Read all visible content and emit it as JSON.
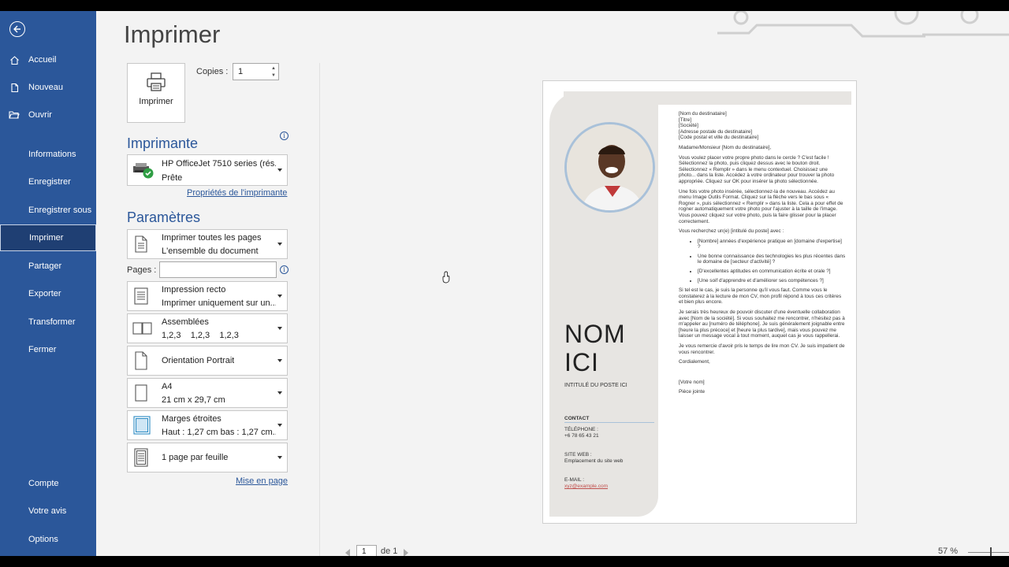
{
  "sidebar": {
    "top_items": [
      {
        "label": "Accueil",
        "icon": "home-icon"
      },
      {
        "label": "Nouveau",
        "icon": "new-document-icon"
      },
      {
        "label": "Ouvrir",
        "icon": "folder-open-icon"
      }
    ],
    "mid_items": [
      "Informations",
      "Enregistrer",
      "Enregistrer sous",
      "Imprimer",
      "Partager",
      "Exporter",
      "Transformer",
      "Fermer"
    ],
    "active": "Imprimer",
    "bottom_items": [
      "Compte",
      "Votre avis",
      "Options"
    ]
  },
  "main": {
    "title": "Imprimer",
    "print_button": "Imprimer",
    "copies_label": "Copies :",
    "copies_value": "1",
    "printer_section": "Imprimante",
    "printer_name": "HP OfficeJet 7510 series (rés...",
    "printer_status": "Prête",
    "printer_props": "Propriétés de l'imprimante",
    "settings_section": "Paramètres",
    "print_what_1": "Imprimer toutes les pages",
    "print_what_2": "L'ensemble du document",
    "pages_label": "Pages :",
    "sides_1": "Impression recto",
    "sides_2": "Imprimer uniquement sur un...",
    "collate_1": "Assemblées",
    "collate_2": "1,2,3    1,2,3    1,2,3",
    "orientation": "Orientation Portrait",
    "paper_1": "A4",
    "paper_2": "21 cm x 29,7 cm",
    "margins_1": "Marges étroites",
    "margins_2": "Haut : 1,27 cm bas : 1,27 cm...",
    "per_sheet": "1 page par feuille",
    "page_setup": "Mise en page"
  },
  "preview": {
    "name_line1": "NOM",
    "name_line2": "ICI",
    "job_title": "INTITULÉ DU POSTE ICI",
    "contact_heading": "CONTACT",
    "phone_label": "TÉLÉPHONE :",
    "phone_value": "+6 78 65 43 21",
    "web_label": "SITE WEB :",
    "web_value": "Emplacement du site web",
    "email_label": "E-MAIL :",
    "email_value": "xyz@example.com",
    "address": [
      "[Nom du destinataire]",
      "[Titre]",
      "[Société]",
      "[Adresse postale du destinataire]",
      "[Code postal et ville du destinataire]"
    ],
    "salutation": "Madame/Monsieur [Nom du destinataire],",
    "p1": "Vous voulez placer votre propre photo dans le cercle ? C'est facile ! Sélectionnez la photo, puis cliquez dessus avec le bouton droit. Sélectionnez « Remplir » dans le menu contextuel. Choisissez une photo... dans la liste. Accédez à votre ordinateur pour trouver la photo appropriée. Cliquez sur OK pour insérer la photo sélectionnée.",
    "p2": "Une fois votre photo insérée, sélectionnez-la de nouveau. Accédez au menu Image Outils Format. Cliquez sur la flèche vers le bas sous « Rogner », puis sélectionnez « Remplir » dans la liste. Cela a pour effet de rogner automatiquement votre photo pour l'ajuster à la taille de l'image. Vous pouvez cliquez sur votre photo, puis la faire glisser pour la placer correctement.",
    "p3": "Vous recherchez un(e) [intitulé du poste] avec :",
    "bullets": [
      "[Nombre] années d'expérience pratique en [domaine d'expertise] ?",
      "Une bonne connaissance des technologies les plus récentes dans le domaine de [secteur d'activité] ?",
      "[D'excellentes aptitudes en communication écrite et orale ?]",
      "[Une soif d'apprendre et d'améliorer ses compétences ?]"
    ],
    "p4": "Si tel est le cas, je suis la personne qu'il vous faut. Comme vous le constaterez à la lecture de mon CV, mon profil répond à tous ces critères et bien plus encore.",
    "p5": "Je serais très heureux de pouvoir discuter d'une éventuelle collaboration avec [Nom de la société]. Si vous souhaitez me rencontrer, n'hésitez pas à m'appeler au [numéro de téléphone]. Je suis généralement joignable entre [heure la plus précoce] et [heure la plus tardive], mais vous pouvez me laisser un message vocal à tout moment, auquel cas je vous rappellerai.",
    "p6": "Je vous remercie d'avoir pris le temps de lire mon CV. Je suis impatient de vous rencontrer.",
    "closing": "Cordialement,",
    "signature": "[Votre nom]",
    "enclosure": "Pièce jointe"
  },
  "footer": {
    "page_value": "1",
    "of_label": "de 1",
    "zoom": "57 %"
  },
  "colors": {
    "sidebar": "#2b579a",
    "accent": "#2b579a",
    "email_link": "#c0504d"
  }
}
